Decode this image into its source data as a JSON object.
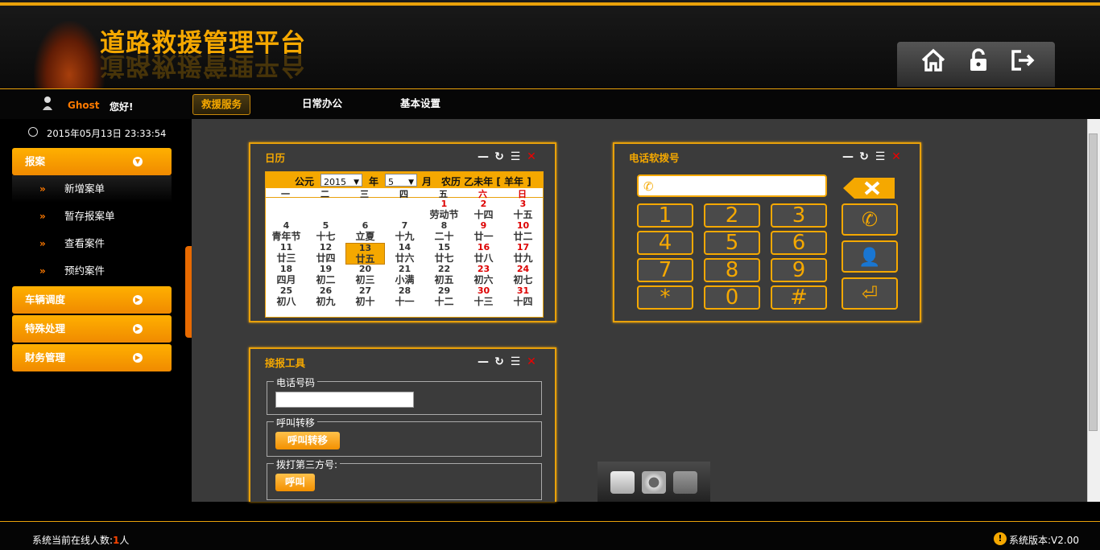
{
  "header": {
    "title": "道路救援管理平台"
  },
  "top_icons": [
    "home-icon",
    "unlock-icon",
    "logout-icon"
  ],
  "user": {
    "name": "Ghost",
    "greet": "您好!"
  },
  "nav": {
    "tabs": [
      "救援服务",
      "日常办公",
      "基本设置"
    ]
  },
  "sidebar": {
    "clock": "2015年05月13日 23:33:54",
    "menus": [
      {
        "label": "报案",
        "items": [
          "新增案单",
          "暂存报案单",
          "查看案件",
          "预约案件"
        ]
      },
      {
        "label": "车辆调度"
      },
      {
        "label": "特殊处理"
      },
      {
        "label": "财务管理"
      }
    ]
  },
  "calendar": {
    "title": "日历",
    "era": "公元",
    "year": "2015",
    "year_unit": "年",
    "month": "5",
    "month_unit": "月",
    "lunar": "农历 乙未年 [ 羊年 ]",
    "weekdays": [
      "一",
      "二",
      "三",
      "四",
      "五",
      "六",
      "日"
    ],
    "days": [
      {
        "n": "1",
        "l": "劳动节",
        "red": true,
        "col": 4,
        "row": 0
      },
      {
        "n": "2",
        "l": "十四",
        "red": true,
        "col": 5,
        "row": 0
      },
      {
        "n": "3",
        "l": "十五",
        "red": true,
        "col": 6,
        "row": 0
      },
      {
        "n": "4",
        "l": "青年节",
        "col": 0,
        "row": 1
      },
      {
        "n": "5",
        "l": "十七",
        "col": 1,
        "row": 1
      },
      {
        "n": "6",
        "l": "立夏",
        "col": 2,
        "row": 1
      },
      {
        "n": "7",
        "l": "十九",
        "col": 3,
        "row": 1
      },
      {
        "n": "8",
        "l": "二十",
        "col": 4,
        "row": 1
      },
      {
        "n": "9",
        "l": "廿一",
        "red": true,
        "col": 5,
        "row": 1
      },
      {
        "n": "10",
        "l": "廿二",
        "red": true,
        "col": 6,
        "row": 1
      },
      {
        "n": "11",
        "l": "廿三",
        "col": 0,
        "row": 2
      },
      {
        "n": "12",
        "l": "廿四",
        "col": 1,
        "row": 2
      },
      {
        "n": "13",
        "l": "廿五",
        "today": true,
        "col": 2,
        "row": 2
      },
      {
        "n": "14",
        "l": "廿六",
        "col": 3,
        "row": 2
      },
      {
        "n": "15",
        "l": "廿七",
        "col": 4,
        "row": 2
      },
      {
        "n": "16",
        "l": "廿八",
        "red": true,
        "col": 5,
        "row": 2
      },
      {
        "n": "17",
        "l": "廿九",
        "red": true,
        "col": 6,
        "row": 2
      },
      {
        "n": "18",
        "l": "四月",
        "col": 0,
        "row": 3
      },
      {
        "n": "19",
        "l": "初二",
        "col": 1,
        "row": 3
      },
      {
        "n": "20",
        "l": "初三",
        "col": 2,
        "row": 3
      },
      {
        "n": "21",
        "l": "小满",
        "col": 3,
        "row": 3
      },
      {
        "n": "22",
        "l": "初五",
        "col": 4,
        "row": 3
      },
      {
        "n": "23",
        "l": "初六",
        "red": true,
        "col": 5,
        "row": 3
      },
      {
        "n": "24",
        "l": "初七",
        "red": true,
        "col": 6,
        "row": 3
      },
      {
        "n": "25",
        "l": "初八",
        "col": 0,
        "row": 4
      },
      {
        "n": "26",
        "l": "初九",
        "col": 1,
        "row": 4
      },
      {
        "n": "27",
        "l": "初十",
        "col": 2,
        "row": 4
      },
      {
        "n": "28",
        "l": "十一",
        "col": 3,
        "row": 4
      },
      {
        "n": "29",
        "l": "十二",
        "col": 4,
        "row": 4
      },
      {
        "n": "30",
        "l": "十三",
        "red": true,
        "col": 5,
        "row": 4
      },
      {
        "n": "31",
        "l": "十四",
        "red": true,
        "col": 6,
        "row": 4
      }
    ]
  },
  "dialer": {
    "title": "电话软拨号",
    "keys": [
      "1",
      "2",
      "3",
      "4",
      "5",
      "6",
      "7",
      "8",
      "9",
      "*",
      "0",
      "#"
    ]
  },
  "tools": {
    "title": "接报工具",
    "phone_legend": "电话号码",
    "transfer_legend": "呼叫转移",
    "transfer_button": "呼叫转移",
    "third_legend": "拨打第三方号:",
    "call_button": "呼叫"
  },
  "footer": {
    "online_label": "系统当前在线人数:",
    "online_count": "1",
    "online_unit": "人",
    "version": "系统版本:V2.00"
  },
  "colors": {
    "accent": "#f5a800",
    "orange": "#ff7a00",
    "red": "#dd0000"
  }
}
